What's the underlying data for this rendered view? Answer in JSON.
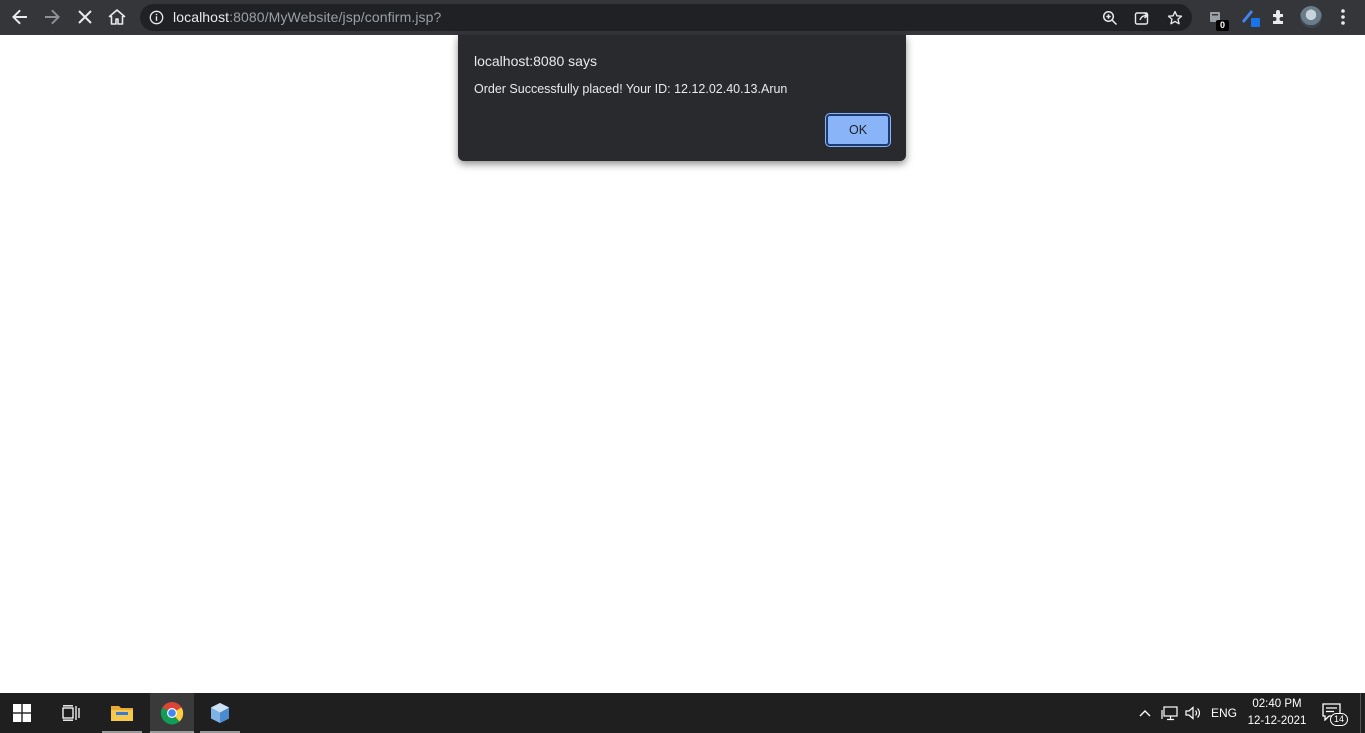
{
  "browser": {
    "url_host": "localhost",
    "url_rest": ":8080/MyWebsite/jsp/confirm.jsp?",
    "extension_badge": "0"
  },
  "dialog": {
    "title": "localhost:8080 says",
    "message": "Order Successfully placed! Your ID: 12.12.02.40.13.Arun",
    "ok_label": "OK"
  },
  "taskbar": {
    "language": "ENG",
    "time": "02:40 PM",
    "date": "12-12-2021",
    "notification_count": "14"
  },
  "colors": {
    "toolbar_bg": "#35363a",
    "omnibox_bg": "#202124",
    "dialog_bg": "#292a2d",
    "ok_button": "#8ab4f8",
    "taskbar_bg": "#1f1f1f"
  }
}
